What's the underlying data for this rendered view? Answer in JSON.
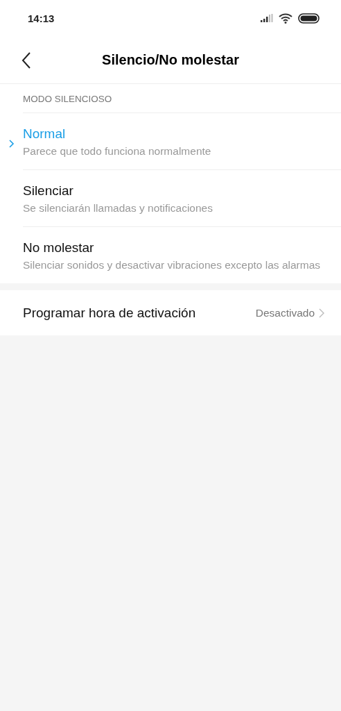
{
  "status_bar": {
    "time": "14:13"
  },
  "header": {
    "title": "Silencio/No molestar"
  },
  "section": {
    "title": "MODO SILENCIOSO"
  },
  "modes": [
    {
      "title": "Normal",
      "subtitle": "Parece que todo funciona normalmente",
      "selected": true
    },
    {
      "title": "Silenciar",
      "subtitle": "Se silenciarán llamadas y notificaciones",
      "selected": false
    },
    {
      "title": "No molestar",
      "subtitle": "Silenciar sonidos y desactivar vibraciones excepto las alarmas",
      "selected": false
    }
  ],
  "schedule": {
    "label": "Programar hora de activación",
    "value": "Desactivado"
  }
}
